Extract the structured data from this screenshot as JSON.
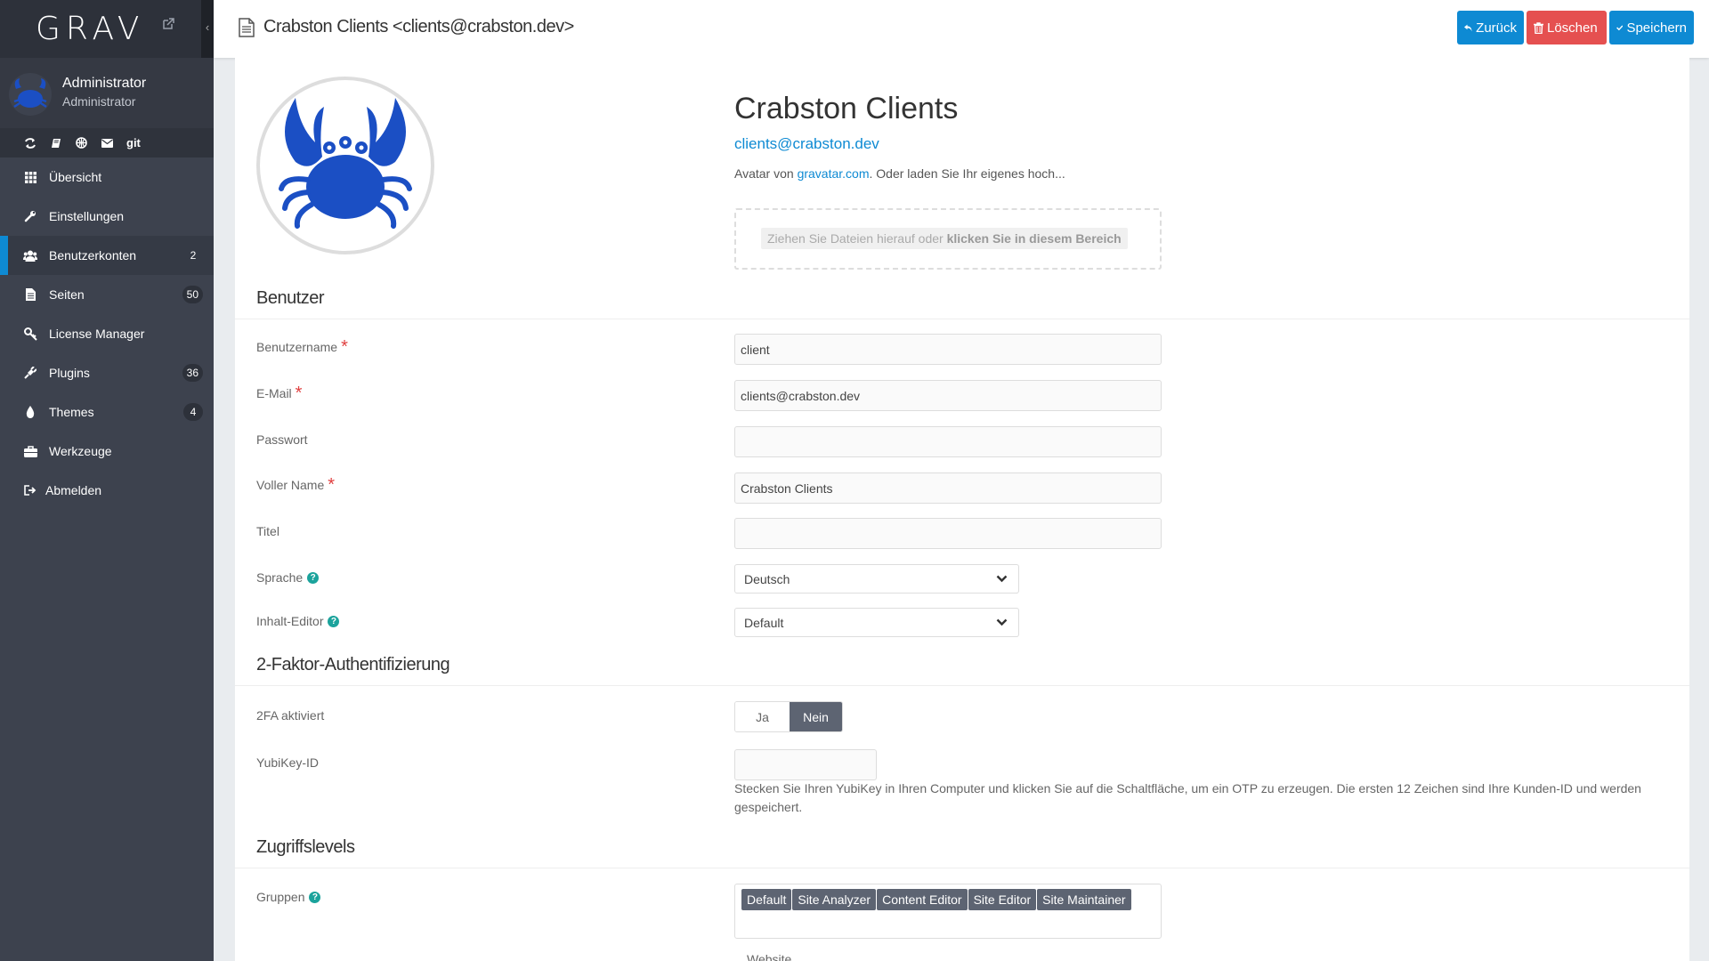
{
  "sidebar": {
    "logo": "GRAV",
    "collapse_glyph": "‹",
    "user": {
      "name": "Administrator",
      "role": "Administrator"
    },
    "quick_tray": {
      "git_label": "git"
    },
    "items": [
      {
        "label": "Übersicht",
        "icon": "dashboard-icon",
        "badge": ""
      },
      {
        "label": "Einstellungen",
        "icon": "wrench-icon",
        "badge": ""
      },
      {
        "label": "Benutzerkonten",
        "icon": "users-icon",
        "badge": "2"
      },
      {
        "label": "Seiten",
        "icon": "file-icon",
        "badge": "50"
      },
      {
        "label": "License Manager",
        "icon": "key-icon",
        "badge": ""
      },
      {
        "label": "Plugins",
        "icon": "plug-icon",
        "badge": "36"
      },
      {
        "label": "Themes",
        "icon": "tint-icon",
        "badge": "4"
      },
      {
        "label": "Werkzeuge",
        "icon": "briefcase-icon",
        "badge": ""
      },
      {
        "label": "Abmelden",
        "icon": "sign-out-icon",
        "badge": ""
      }
    ]
  },
  "header": {
    "title": "Crabston Clients <clients@crabston.dev>",
    "back_label": "Zurück",
    "delete_label": "Löschen",
    "save_label": "Speichern"
  },
  "profile": {
    "name": "Crabston Clients",
    "email": "clients@crabston.dev",
    "avatar_note_prefix": "Avatar von ",
    "avatar_note_link": "gravatar.com",
    "avatar_note_suffix": ". Oder laden Sie Ihr eigenes hoch...",
    "dropzone_prefix": "Ziehen Sie Dateien hierauf oder ",
    "dropzone_bold": "klicken Sie in diesem Bereich"
  },
  "sections": {
    "user": "Benutzer",
    "twofa": "2-Faktor-Authentifizierung",
    "access": "Zugriffslevels"
  },
  "fields": {
    "username": {
      "label": "Benutzername",
      "value": "client"
    },
    "email": {
      "label": "E-Mail",
      "value": "clients@crabston.dev"
    },
    "password": {
      "label": "Passwort",
      "value": ""
    },
    "fullname": {
      "label": "Voller Name",
      "value": "Crabston Clients"
    },
    "title": {
      "label": "Titel",
      "value": ""
    },
    "language": {
      "label": "Sprache",
      "value": "Deutsch"
    },
    "editor": {
      "label": "Inhalt-Editor",
      "value": "Default"
    },
    "twofa_enabled": {
      "label": "2FA aktiviert",
      "yes": "Ja",
      "no": "Nein",
      "selected": "Nein"
    },
    "yubikey": {
      "label": "YubiKey-ID",
      "value": "",
      "help": "Stecken Sie Ihren YubiKey in Ihren Computer und klicken Sie auf die Schaltfläche, um ein OTP zu erzeugen. Die ersten 12 Zeichen sind Ihre Kunden-ID und werden gespeichert."
    },
    "groups": {
      "label": "Gruppen",
      "tags": [
        "Default",
        "Site Analyzer",
        "Content Editor",
        "Site Editor",
        "Site Maintainer"
      ]
    }
  },
  "next_section_cut": "Website",
  "colors": {
    "accent": "#0e8ad3",
    "danger": "#e55050",
    "sidebar": "#3d424e",
    "tag": "#5d6472"
  }
}
